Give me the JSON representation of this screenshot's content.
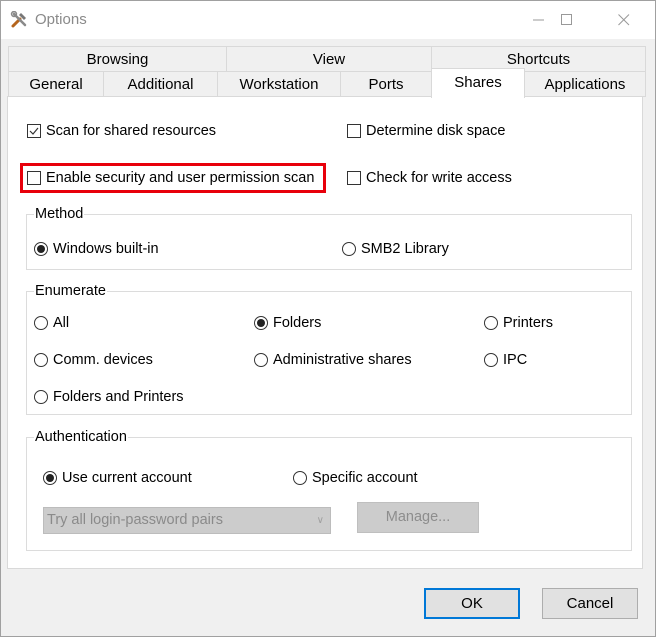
{
  "window": {
    "title": "Options",
    "icon": "tools-icon",
    "controls": {
      "minimize": "minimize-icon",
      "maximize": "maximize-icon",
      "close": "close-icon"
    }
  },
  "tabs": {
    "row1": [
      {
        "label": "Browsing"
      },
      {
        "label": "View"
      },
      {
        "label": "Shortcuts"
      }
    ],
    "row2": [
      {
        "label": "General"
      },
      {
        "label": "Additional"
      },
      {
        "label": "Workstation"
      },
      {
        "label": "Ports"
      },
      {
        "label": "Shares",
        "active": true
      },
      {
        "label": "Applications"
      }
    ]
  },
  "options": {
    "scan_shared": {
      "label": "Scan for shared resources",
      "checked": true
    },
    "determine_disk": {
      "label": "Determine disk space",
      "checked": false
    },
    "security_scan": {
      "label": "Enable security and user permission scan",
      "checked": false,
      "highlighted": true
    },
    "write_access": {
      "label": "Check for write access",
      "checked": false
    }
  },
  "method": {
    "label": "Method",
    "options": [
      {
        "label": "Windows built-in",
        "selected": true
      },
      {
        "label": "SMB2 Library",
        "selected": false
      }
    ]
  },
  "enumerate": {
    "label": "Enumerate",
    "options": [
      {
        "label": "All",
        "selected": false
      },
      {
        "label": "Folders",
        "selected": true
      },
      {
        "label": "Printers",
        "selected": false
      },
      {
        "label": "Comm. devices",
        "selected": false
      },
      {
        "label": "Administrative shares",
        "selected": false
      },
      {
        "label": "IPC",
        "selected": false
      },
      {
        "label": "Folders and Printers",
        "selected": false
      }
    ]
  },
  "authentication": {
    "label": "Authentication",
    "options": [
      {
        "label": "Use current account",
        "selected": true
      },
      {
        "label": "Specific account",
        "selected": false
      }
    ],
    "combo_value": "Try all login-password pairs",
    "manage_label": "Manage..."
  },
  "buttons": {
    "ok": "OK",
    "cancel": "Cancel"
  },
  "colors": {
    "highlight": "#e8000b",
    "default_button_border": "#0078d7"
  }
}
